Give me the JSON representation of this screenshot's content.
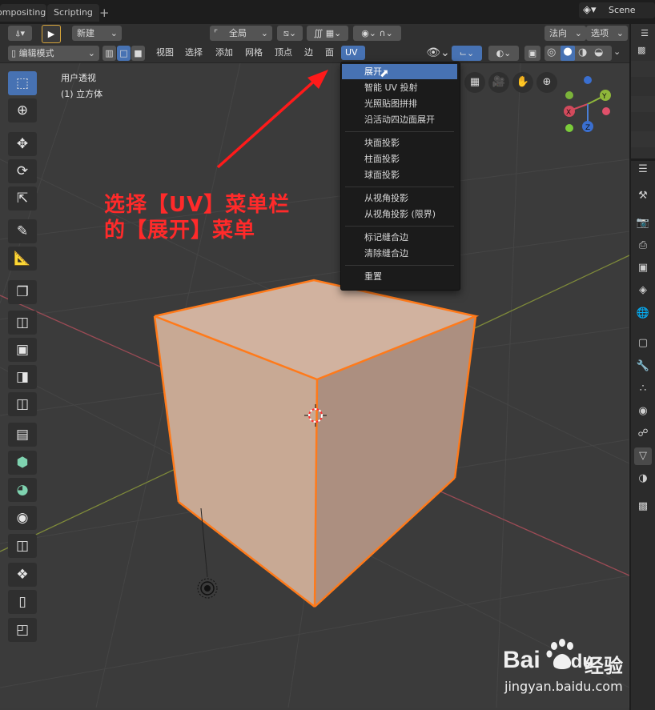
{
  "workspace_tabs": [
    {
      "label": "ompositing"
    },
    {
      "label": "Scripting"
    },
    {
      "label": "+"
    }
  ],
  "scene": {
    "label": "Scene",
    "icon": "scene-icon"
  },
  "header1": {
    "new_label": "新建",
    "transform_orientation": "全局",
    "normal_label": "法向",
    "options_label": "选项"
  },
  "header2": {
    "mode_label": "编辑模式",
    "menus": [
      "视图",
      "选择",
      "添加",
      "网格",
      "顶点",
      "边",
      "面",
      "UV"
    ]
  },
  "viewport": {
    "view_name": "用户透视",
    "object_name": "(1) 立方体",
    "gizmo": {
      "x": "X",
      "y": "Y",
      "z": "Z"
    }
  },
  "uv_menu": {
    "items": [
      "展开",
      "智能 UV 投射",
      "光照贴图拼排",
      "沿活动四边面展开",
      "块面投影",
      "柱面投影",
      "球面投影",
      "从视角投影",
      "从视角投影 (限界)",
      "标记缝合边",
      "清除缝合边",
      "重置"
    ]
  },
  "annotation": {
    "line1": "选择【UV】菜单栏",
    "line2": "的【展开】菜单",
    "color": "#ff2a2a"
  },
  "watermark": {
    "brand_text": "Bai",
    "brand_text2": "du",
    "brand_cn": "经验",
    "url": "jingyan.baidu.com"
  },
  "colors": {
    "accent": "#4772b3",
    "selection_edge": "#ff7a1a",
    "cube_face": "#c9ab96"
  }
}
